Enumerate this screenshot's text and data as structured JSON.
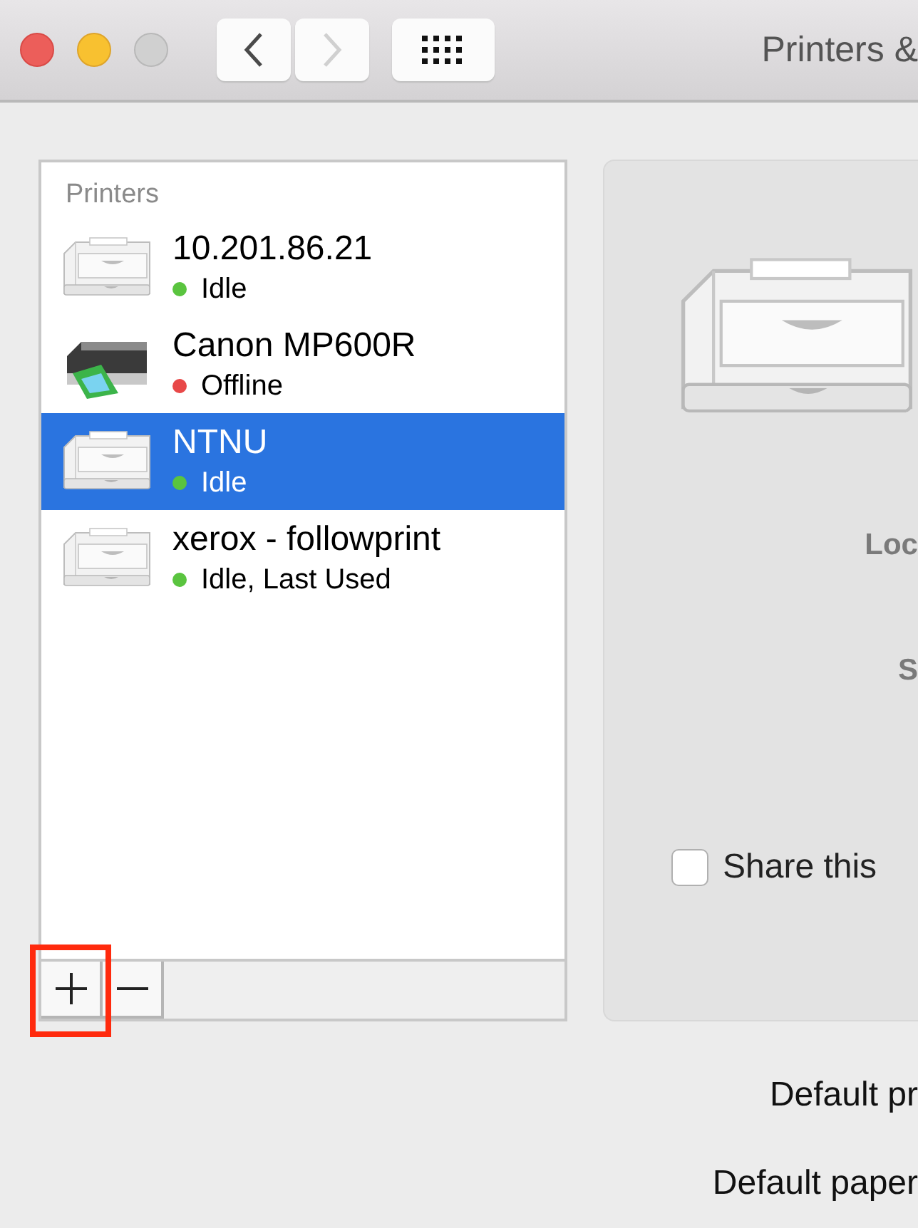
{
  "window": {
    "title": "Printers &"
  },
  "toolbar": {
    "back_enabled": true,
    "forward_enabled": false
  },
  "printer_list": {
    "header": "Printers",
    "items": [
      {
        "name": "10.201.86.21",
        "status": "Idle",
        "color": "#5ac43f",
        "kind": "laser",
        "selected": false
      },
      {
        "name": "Canon MP600R",
        "status": "Offline",
        "color": "#e84848",
        "kind": "inkjet",
        "selected": false
      },
      {
        "name": "NTNU",
        "status": "Idle",
        "color": "#5ac43f",
        "kind": "laser",
        "selected": true
      },
      {
        "name": "xerox - followprint",
        "status": "Idle, Last Used",
        "color": "#5ac43f",
        "kind": "laser",
        "selected": false
      }
    ]
  },
  "details": {
    "kind": "laser",
    "labels": [
      "Loc",
      "S"
    ],
    "share": {
      "label": "Share this",
      "checked": false
    }
  },
  "defaults": [
    "Default pr",
    "Default paper"
  ]
}
